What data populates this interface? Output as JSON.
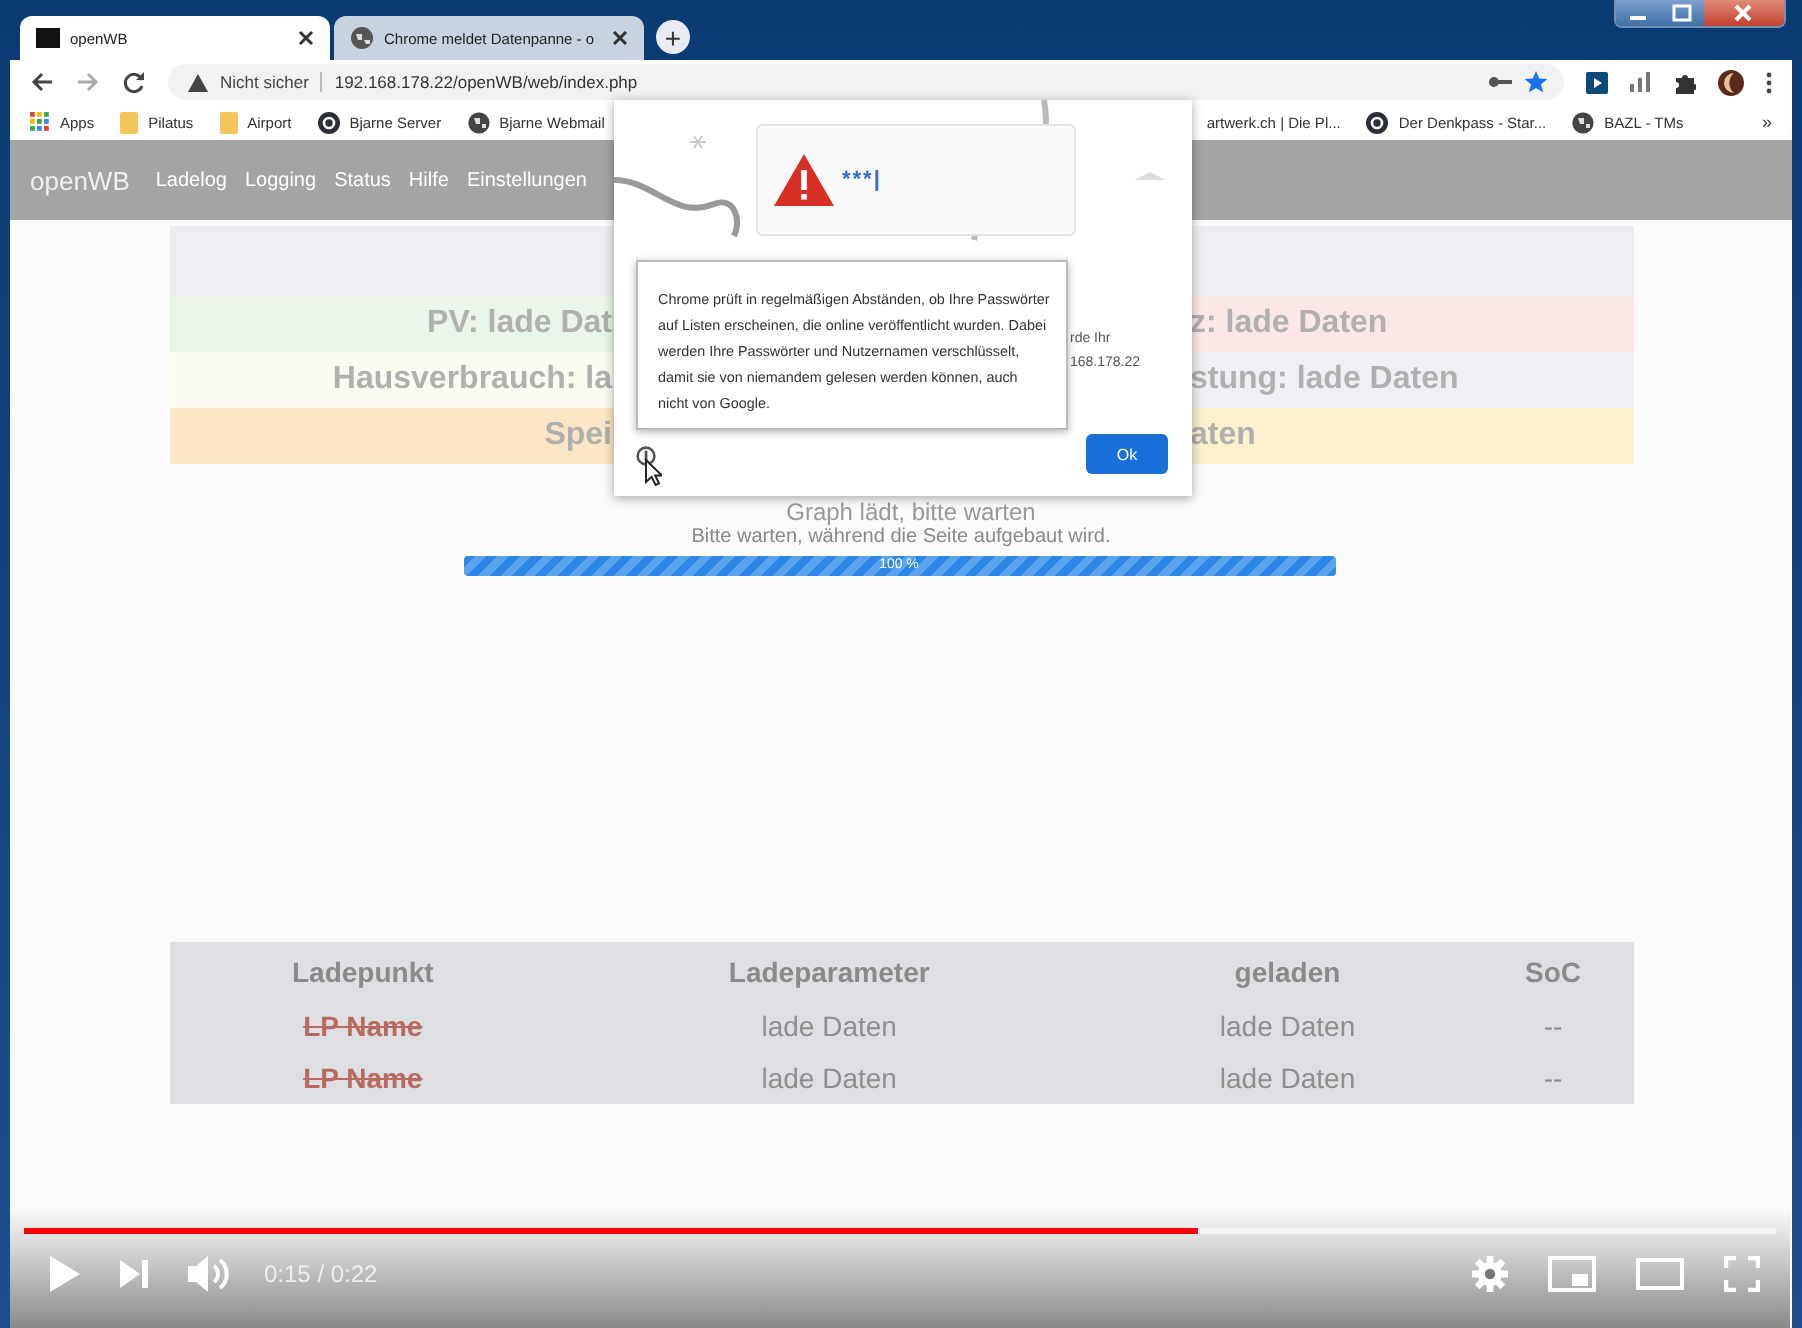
{
  "browser": {
    "tabs": [
      {
        "title": "openWB",
        "selected": true
      },
      {
        "title": "Chrome meldet Datenpanne - o",
        "selected": false
      }
    ],
    "new_tab": "+",
    "security": "Nicht sicher",
    "url": "192.168.178.22/openWB/web/index.php",
    "bookmarks": [
      {
        "label": "Apps",
        "kind": "apps"
      },
      {
        "label": "Pilatus",
        "kind": "folder"
      },
      {
        "label": "Airport",
        "kind": "folder"
      },
      {
        "label": "Bjarne Server",
        "kind": "letter"
      },
      {
        "label": "Bjarne Webmail",
        "kind": "globe"
      }
    ],
    "bookmarks_right": [
      {
        "label": "artwerk.ch | Die Pl...",
        "kind": "none"
      },
      {
        "label": "Der Denkpass - Star...",
        "kind": "letter"
      },
      {
        "label": "BAZL - TMs",
        "kind": "globe"
      }
    ],
    "more": "»"
  },
  "page": {
    "brand": "openWB",
    "nav": [
      "Ladelog",
      "Logging",
      "Status",
      "Hilfe",
      "Einstellungen"
    ],
    "status_rows": [
      {
        "cells": [
          {
            "text": "PV: lade Dat",
            "color": "#e9f6e9"
          },
          {
            "text": "z: lade Daten",
            "color": "#fbe7e5"
          }
        ]
      },
      {
        "cells": [
          {
            "text": "Hausverbrauch: la",
            "color": "#fbfbf2"
          },
          {
            "text": "stung: lade Daten",
            "color": "#eef0f3"
          }
        ]
      },
      {
        "cells": [
          {
            "text": "Spei",
            "color": "#fbe7c6"
          },
          {
            "text": "aten",
            "color": "#fbf1cc"
          }
        ]
      }
    ],
    "graph_note": "Graph lädt, bitte warten",
    "loading": "Bitte warten, während die Seite aufgebaut wird.",
    "progress": {
      "level": 1,
      "label": "100 %"
    },
    "table": {
      "columns": [
        "Ladepunkt",
        "Ladeparameter",
        "geladen",
        "SoC"
      ],
      "rows": [
        {
          "cells": [
            "LP Name",
            "lade Daten",
            "lade Daten",
            "--"
          ]
        },
        {
          "cells": [
            "LP Name",
            "lade Daten",
            "lade Daten",
            "--"
          ]
        }
      ]
    }
  },
  "dialog": {
    "field": "***|",
    "message": "Chrome prüft in regelmäßigen Abständen, ob Ihre Passwörter auf Listen erscheinen, die online veröffentlicht wurden. Dabei werden Ihre Passwörter und Nutzernamen verschlüsselt, damit sie von niemandem gelesen werden können, auch nicht von Google.",
    "behind_text": [
      "rde Ihr",
      "168.178.22"
    ],
    "button": "Ok"
  },
  "video": {
    "level": 0.67,
    "time": "0:15 / 0:22"
  }
}
